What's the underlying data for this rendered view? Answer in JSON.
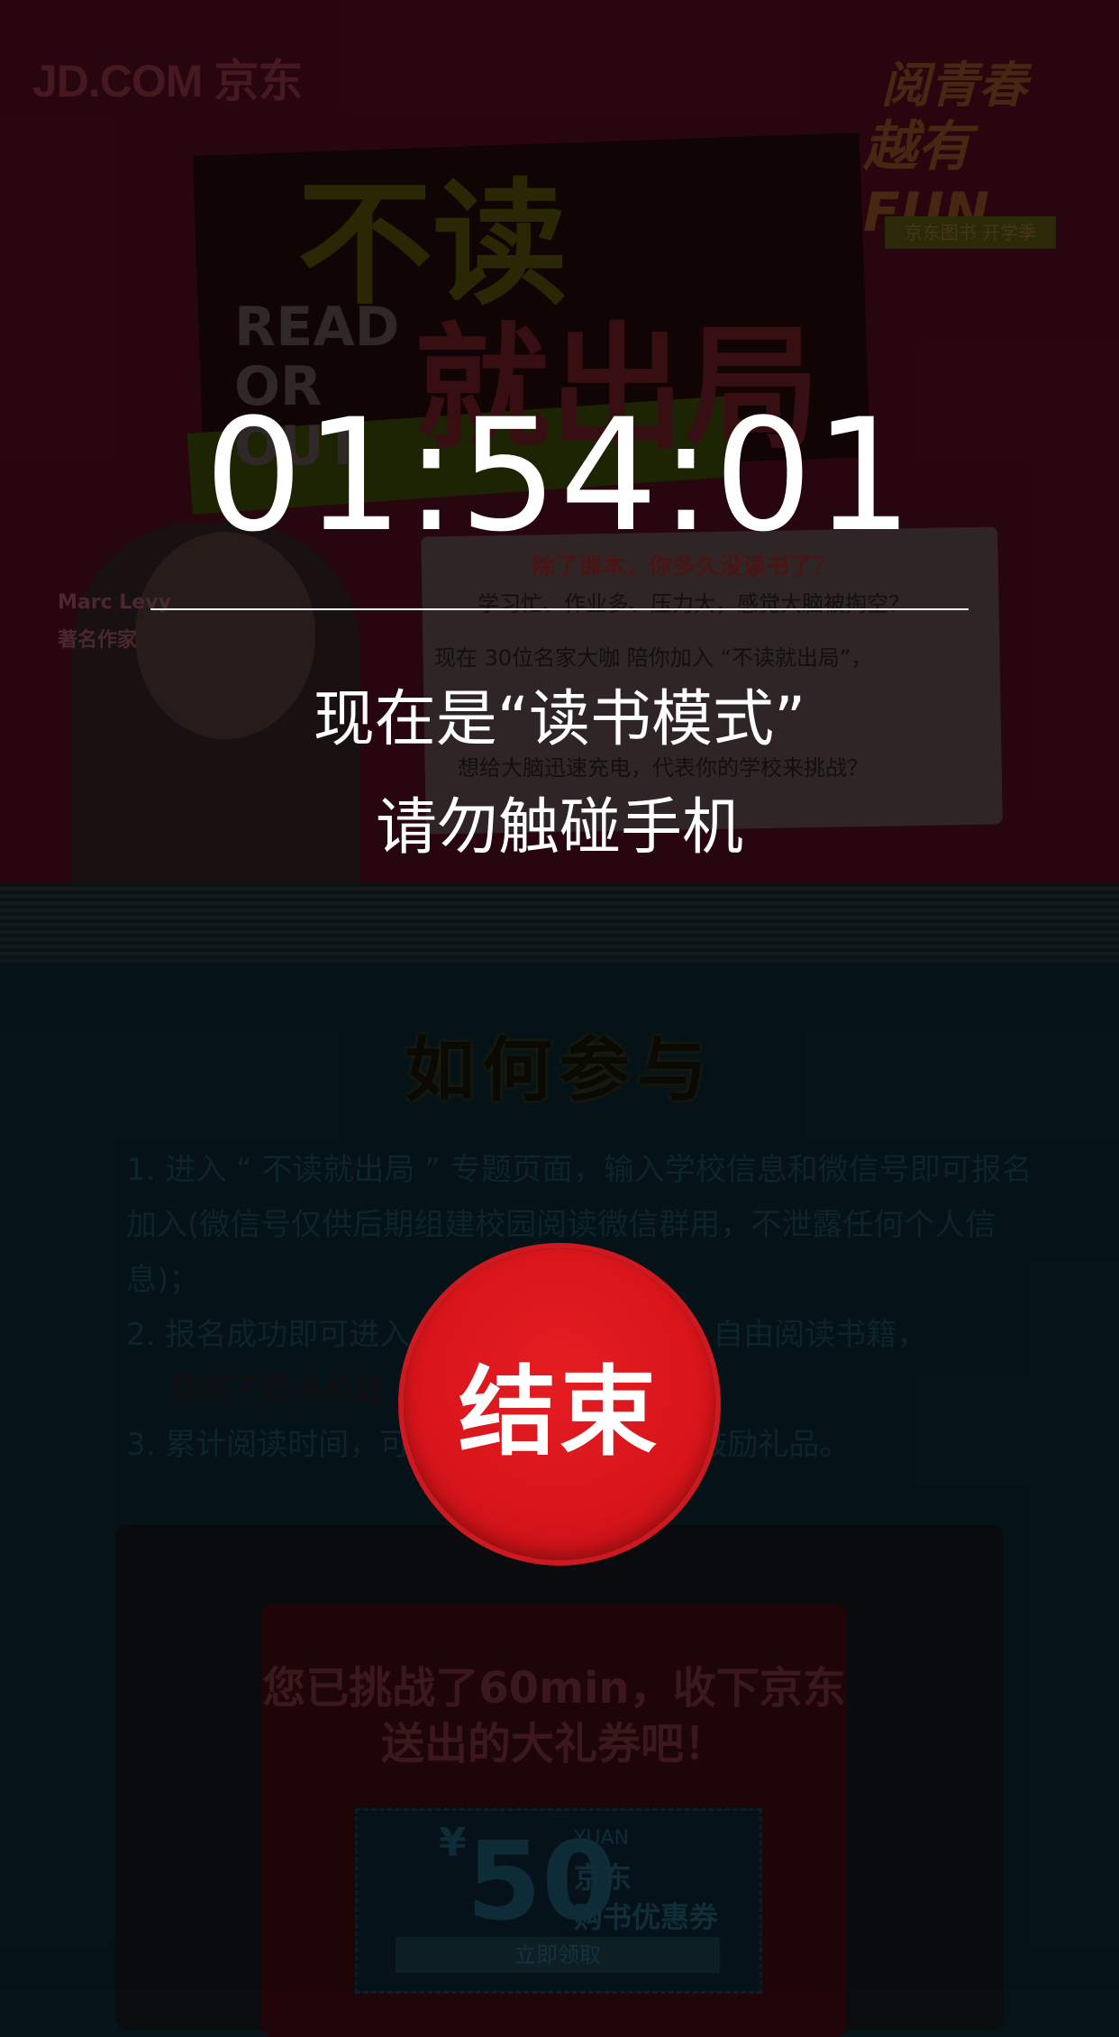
{
  "background": {
    "brand_logo": "JD.COM 京东",
    "badge": {
      "line1": "阅青春",
      "line2": "越有FUN",
      "tag": "京东图书 开学季"
    },
    "hero": {
      "title_top": "不读",
      "title_bottom": "就出局",
      "read_or_out": "READ OR OUT"
    },
    "author": {
      "name": "Marc Levy",
      "role": "著名作家"
    },
    "speech": {
      "line1": "除了课本，你多久没读书了？",
      "line2": "学习忙、作业多、压力大，感觉大脑被掏空？",
      "line3": "现在 30位名家大咖 陪你加入 “不读就出局”，",
      "line4": "想给大脑迅速充电，代表你的学校来挑战？"
    },
    "howto": {
      "title": "如何参与",
      "steps": [
        "1. 进入 “ 不读就出局 ” 专题页面，输入学校信息和微信号即可报名加入(微信号仅供后期组建校园阅读微信群用，不泄露任何个人信息)；",
        "2. 报名成功即可进入",
        "计时后，自由阅读书籍，",
        "期间不用手机进",
        "计时清零；",
        "3. 累计阅读时间，可",
        "阅读鼓励礼品。"
      ]
    },
    "reward": {
      "text": "您已挑战了60min，收下京东送出的大礼券吧！",
      "currency": "¥",
      "amount": "50",
      "unit": "YUAN",
      "ticket_line1": "京东",
      "ticket_line2": "购书优惠券",
      "claim": "立即领取"
    }
  },
  "overlay": {
    "timer": "01:54:01",
    "message_line1": "现在是“读书模式”",
    "message_line2": "请勿触碰手机",
    "end_button_label": "结束"
  },
  "colors": {
    "end_button": "#d8151b",
    "overlay_text": "#ffffff"
  }
}
